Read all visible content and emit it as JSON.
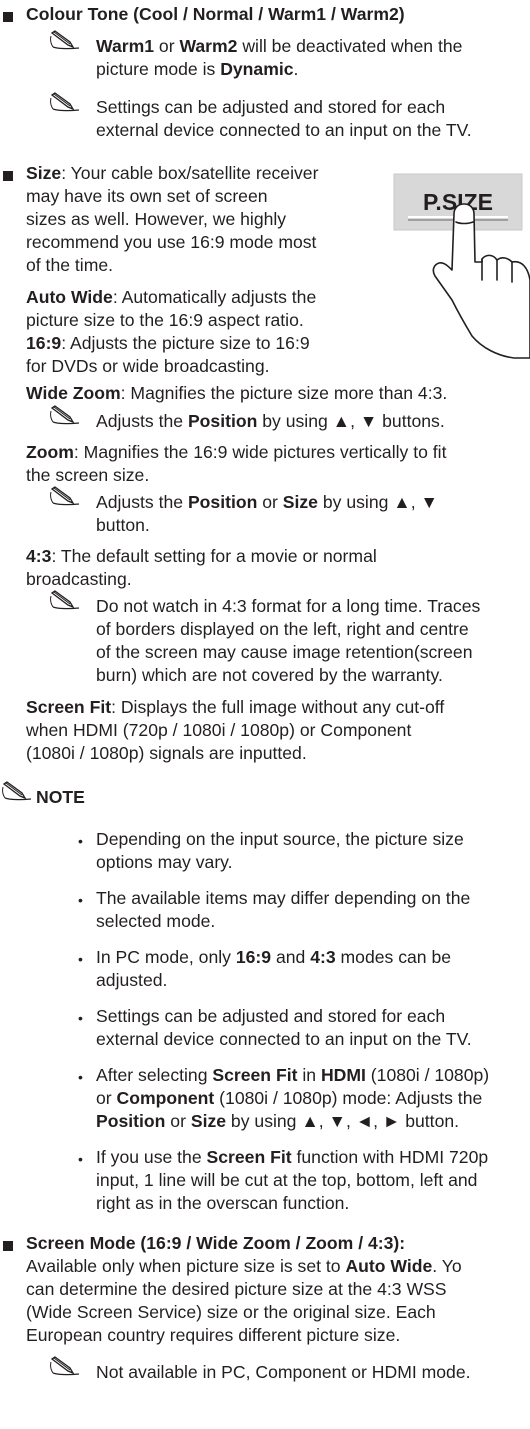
{
  "sections": {
    "colour_tone": {
      "title": "Colour Tone (Cool / Normal / Warm1 / Warm2)",
      "note1": {
        "b1": "Warm1",
        "t1": " or ",
        "b2": "Warm2",
        "t2": " will be deactivated when the",
        "l2a": "picture mode is ",
        "l2b": "Dynamic",
        "l2c": "."
      },
      "note2": {
        "l1": "Settings can be adjusted and stored for each",
        "l2": "external device connected to an input on the TV."
      }
    },
    "size": {
      "label": "Size",
      "intro": [
        ": Your cable box/satellite receiver",
        "may have its own set of screen",
        "sizes as well. However, we highly",
        "recommend you use 16:9 mode most",
        "of the time."
      ],
      "button_label": "P.SIZE",
      "auto_wide": {
        "label": "Auto Wide",
        "l1": ": Automatically adjusts the",
        "l2": "picture size to the 16:9 aspect ratio."
      },
      "r169": {
        "label": "16:9",
        "l1": ": Adjusts the picture size to 16:9",
        "l2": "for DVDs or wide broadcasting."
      },
      "wide_zoom": {
        "label": "Wide Zoom",
        "l1": ": Magnifies the picture size more than 4:3.",
        "note_a": "Adjusts the ",
        "note_b": "Position",
        "note_c": " by using ▲, ▼ buttons."
      },
      "zoom": {
        "label": "Zoom",
        "l1": ": Magnifies the 16:9 wide pictures vertically to fit",
        "l2": "the screen size.",
        "note_a": "Adjusts the ",
        "note_b": "Position",
        "note_c": " or ",
        "note_d": "Size",
        "note_e": " by using ▲, ▼",
        "note_l2": "button."
      },
      "r43": {
        "label": "4:3",
        "l1": ": The default setting for a movie or normal",
        "l2": "broadcasting.",
        "note": [
          "Do not watch in 4:3 format for a long time. Traces",
          "of borders displayed on the left, right and centre",
          "of the screen may cause image retention(screen",
          "burn) which are not covered by the warranty."
        ]
      },
      "screen_fit": {
        "label": "Screen Fit",
        "l1": ": Displays the full image without any cut-off",
        "l2": "when HDMI (720p / 1080i / 1080p) or Component",
        "l3": "(1080i / 1080p) signals are inputted."
      }
    },
    "note_heading": "NOTE",
    "note_items": {
      "i1": [
        "Depending on the input source, the picture size",
        "options may vary."
      ],
      "i2": [
        "The available items may differ depending on the",
        "selected mode."
      ],
      "i3": {
        "a": "In PC mode, only ",
        "b": "16:9",
        "c": " and ",
        "d": "4:3",
        "e": " modes can be",
        "l2": "adjusted."
      },
      "i4": [
        "Settings can be adjusted and stored for each",
        "external device connected to an input on the TV."
      ],
      "i5": {
        "a": "After selecting ",
        "b": "Screen Fit",
        "c": " in ",
        "d": "HDMI",
        "e": " (1080i / 1080p)",
        "l2a": "or ",
        "l2b": "Component",
        "l2c": " (1080i / 1080p) mode: Adjusts the",
        "l3a": "Position",
        "l3b": " or ",
        "l3c": "Size",
        "l3d": " by using ▲, ▼, ◄, ► button."
      },
      "i6": {
        "a": "If you use the ",
        "b": "Screen Fit",
        "c": " function with HDMI 720p",
        "l2": "input, 1 line will be cut at the top, bottom, left and",
        "l3": "right as in the overscan function."
      }
    },
    "screen_mode": {
      "title": "Screen Mode (16:9 / Wide Zoom / Zoom / 4:3)",
      "l1b": ":",
      "l2a": "Available only when picture size is set to ",
      "l2b": "Auto Wide",
      "l2c": ". Yo",
      "l3": "can determine the desired picture size at the 4:3 WSS",
      "l4": "(Wide Screen Service) size or the original size. Each",
      "l5": "European country requires different picture size.",
      "note": "Not available in PC, Component or HDMI mode."
    }
  }
}
